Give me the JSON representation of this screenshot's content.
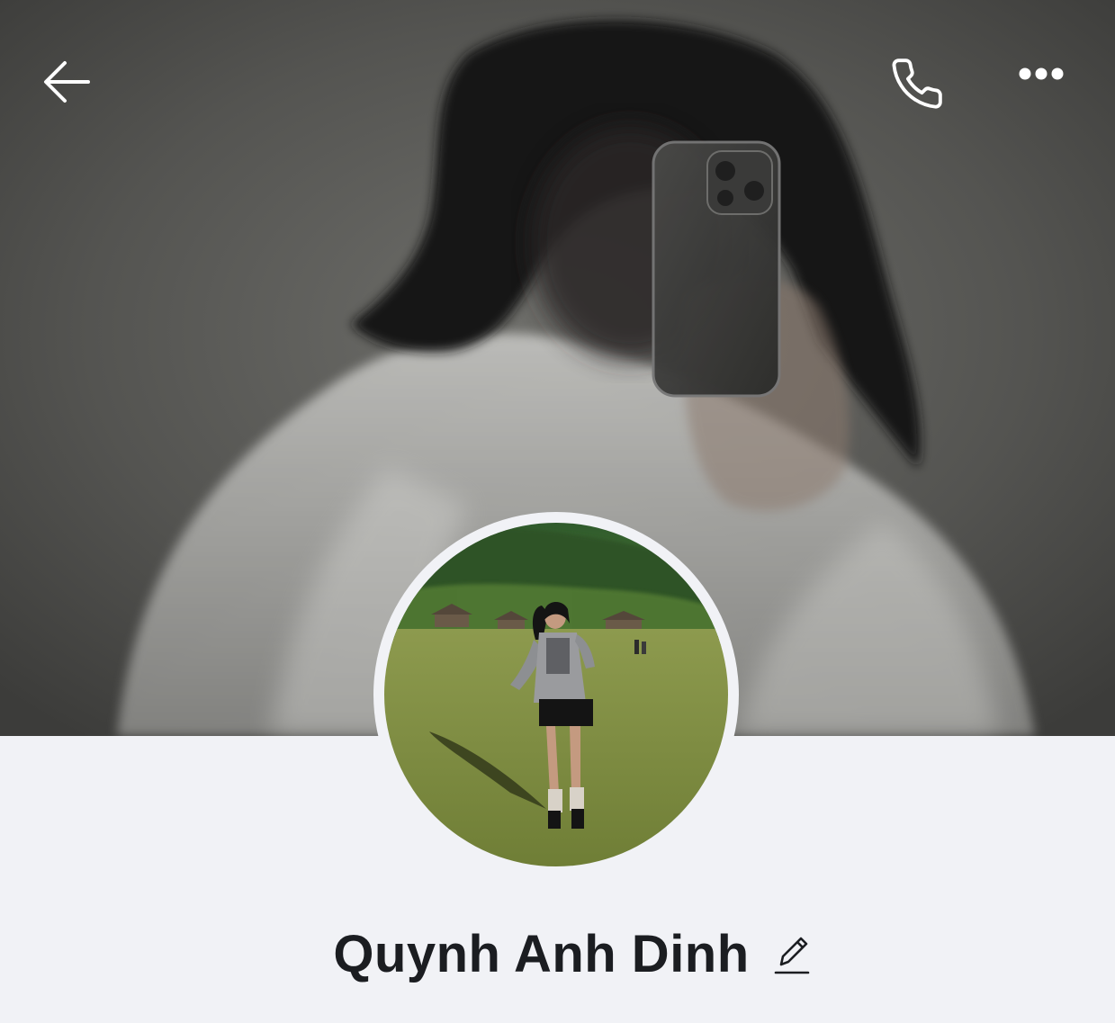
{
  "profile": {
    "name": "Quynh Anh Dinh"
  },
  "header": {
    "back_icon": "arrow-left-icon",
    "call_icon": "phone-icon",
    "more_icon": "more-horizontal-icon"
  },
  "edit_icon": "pencil-icon",
  "colors": {
    "background": "#f1f2f6",
    "name_text": "#1b1d21",
    "icon_light": "#ffffff"
  }
}
